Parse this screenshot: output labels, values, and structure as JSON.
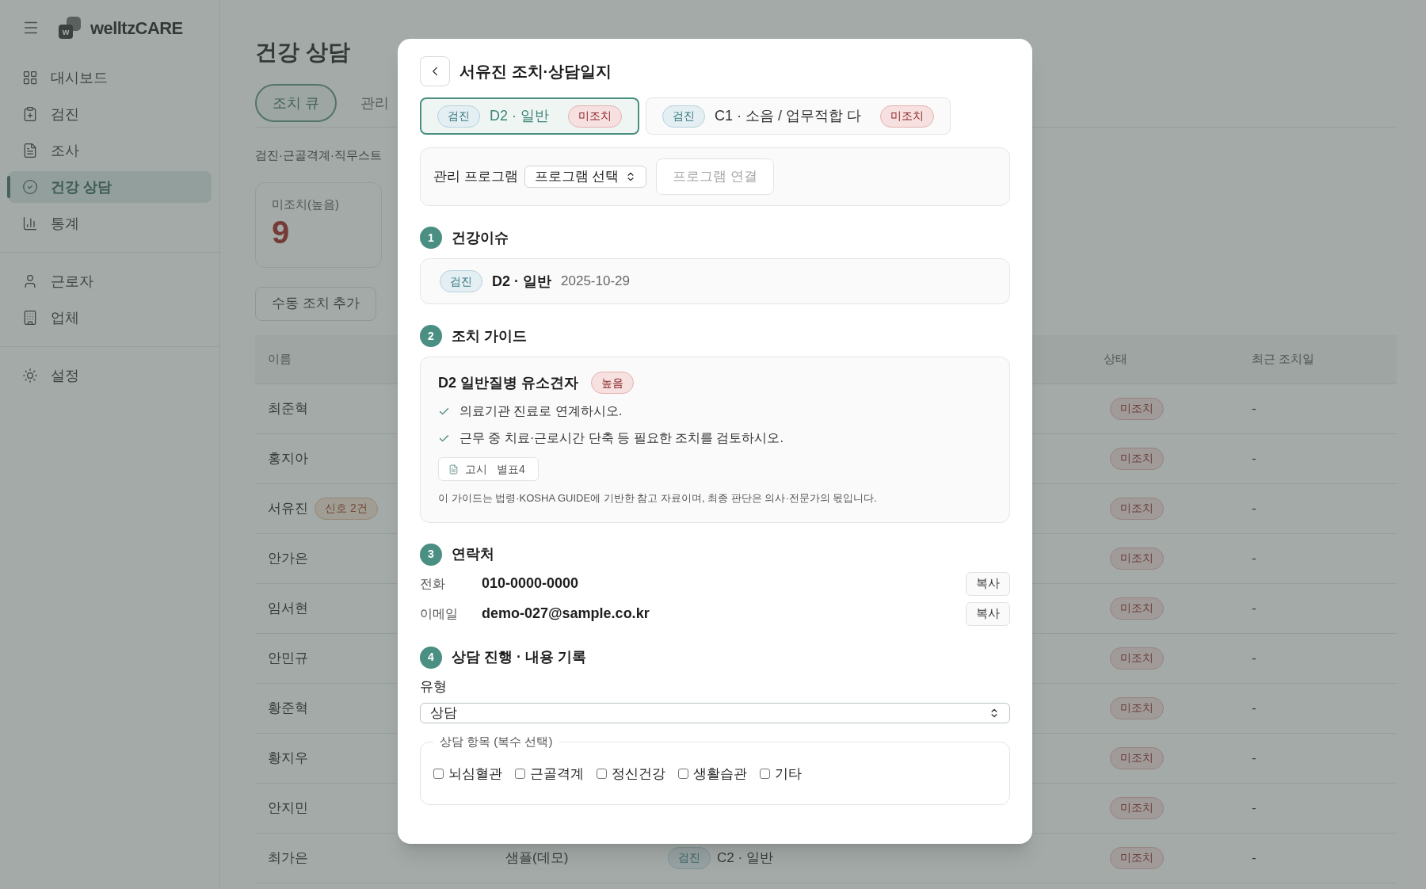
{
  "sidebar": {
    "logo_letter": "w",
    "brand": "welltzCARE",
    "groups": [
      {
        "items": [
          {
            "label": "대시보드",
            "selected": false
          },
          {
            "label": "검진",
            "selected": false
          },
          {
            "label": "조사",
            "selected": false
          },
          {
            "label": "건강 상담",
            "selected": true
          },
          {
            "label": "통계",
            "selected": false
          }
        ]
      },
      {
        "items": [
          {
            "label": "근로자",
            "selected": false
          },
          {
            "label": "업체",
            "selected": false
          }
        ]
      },
      {
        "items": [
          {
            "label": "설정",
            "selected": false
          }
        ]
      }
    ]
  },
  "page": {
    "title": "건강 상담",
    "tabs": [
      {
        "label": "조치 큐",
        "selected": true
      },
      {
        "label": "관리",
        "selected": false
      }
    ],
    "subtitle": "검진·근골격계·직무스트",
    "stat": {
      "label": "미조치(높음)",
      "value": "9"
    },
    "buttons": [
      "수동 조치 추가"
    ],
    "table": {
      "columns": [
        "이름",
        "상태",
        "최근 조치일"
      ],
      "rows": [
        {
          "name": "최준혁",
          "status": "미조치",
          "last_action": "-"
        },
        {
          "name": "홍지아",
          "status": "미조치",
          "last_action": "-"
        },
        {
          "name": "서유진",
          "tag": "신호 2건",
          "status": "미조치",
          "last_action": "-"
        },
        {
          "name": "안가은",
          "status": "미조치",
          "last_action": "-"
        },
        {
          "name": "임서현",
          "status": "미조치",
          "last_action": "-"
        },
        {
          "name": "안민규",
          "status": "미조치",
          "last_action": "-"
        },
        {
          "name": "황준혁",
          "status": "미조치",
          "last_action": "-"
        },
        {
          "name": "황지우",
          "status": "미조치",
          "last_action": "-"
        },
        {
          "name": "안지민",
          "status": "미조치",
          "last_action": "-"
        },
        {
          "name": "최가은",
          "company": "샘플(데모)",
          "source": "검진",
          "issue": "C2 · 일반",
          "status": "미조치",
          "last_action": "-"
        }
      ]
    }
  },
  "modal": {
    "title": "서유진 조치·상담일지",
    "issue_tabs": [
      {
        "source": "검진",
        "label": "D2 · 일반",
        "status": "미조치",
        "selected": true
      },
      {
        "source": "검진",
        "label": "C1 · 소음 / 업무적합 다",
        "status": "미조치",
        "selected": false
      }
    ],
    "program": {
      "label": "관리 프로그램",
      "select_value": "프로그램 선택",
      "button": "프로그램 연결",
      "button_disabled": true
    },
    "sections": [
      {
        "number": "1",
        "title": "건강이슈"
      },
      {
        "number": "2",
        "title": "조치 가이드"
      },
      {
        "number": "3",
        "title": "연락처"
      },
      {
        "number": "4",
        "title": "상담 진행 · 내용 기록"
      }
    ],
    "issue": {
      "source": "검진",
      "label": "D2 · 일반",
      "date": "2025-10-29"
    },
    "guide": {
      "title": "D2 일반질병 유소견자",
      "level": "높음",
      "checks": [
        "의료기관 진료로 연계하시오.",
        "근무 중 치료·근로시간 단축 등 필요한 조치를 검토하시오."
      ],
      "reference": [
        "고시",
        "별표4"
      ],
      "note": "이 가이드는 법령·KOSHA GUIDE에 기반한 참고 자료이며, 최종 판단은 의사·전문가의 몫입니다."
    },
    "contacts": [
      {
        "label": "전화",
        "value": "010-0000-0000",
        "button": "복사"
      },
      {
        "label": "이메일",
        "value": "demo-027@sample.co.kr",
        "button": "복사"
      }
    ],
    "record": {
      "type_label": "유형",
      "type_value": "상담",
      "items_legend": "상담 항목 (복수 선택)",
      "items": [
        {
          "label": "뇌심혈관",
          "checked": false
        },
        {
          "label": "근골격계",
          "checked": false
        },
        {
          "label": "정신건강",
          "checked": false
        },
        {
          "label": "생활습관",
          "checked": false
        },
        {
          "label": "기타",
          "checked": false
        }
      ]
    }
  }
}
